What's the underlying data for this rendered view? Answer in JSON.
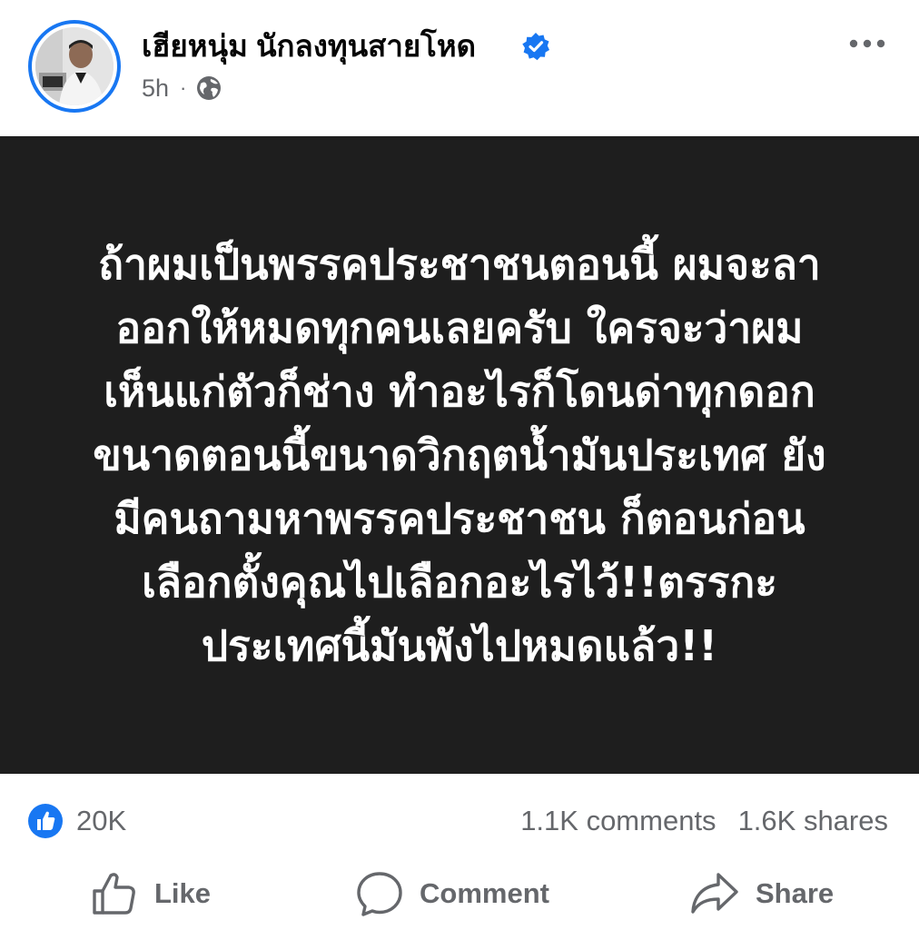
{
  "post": {
    "author": "เฮียหนุ่ม นักลงทุนสายโหด",
    "verified": true,
    "time": "5h",
    "separator": "·",
    "audience_icon": "globe-icon",
    "text": "ถ้าผมเป็นพรรคประชาชนตอนนี้ ผมจะลา\nออกให้หมดทุกคนเลยครับ ใครจะว่าผม\nเห็นแก่ตัวก็ช่าง ทำอะไรก็โดนด่าทุกดอก\nขนาดตอนนี้ขนาดวิกฤตน้ำมันประเทศ ยัง\nมีคนถามหาพรรคประชาชน ก็ตอนก่อน\nเลือกตั้งคุณไปเลือกอะไรไว้!!ตรรกะ\nประเทศนี้มันพังไปหมดแล้ว!!",
    "background_color": "#1e1e1e",
    "text_color": "#ffffff"
  },
  "stats": {
    "likes": "20K",
    "comments": "1.1K comments",
    "shares": "1.6K shares"
  },
  "actions": {
    "like": "Like",
    "comment": "Comment",
    "share": "Share"
  },
  "colors": {
    "accent": "#1877f2",
    "secondary_text": "#65676b"
  }
}
